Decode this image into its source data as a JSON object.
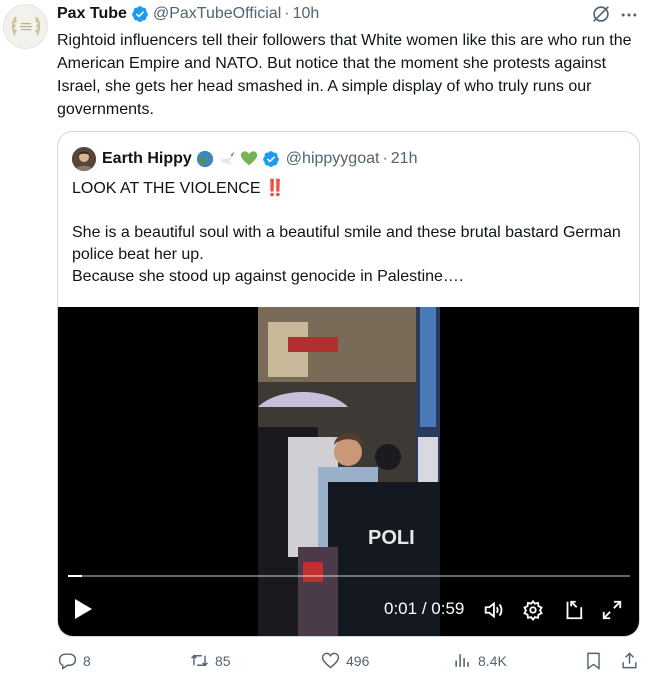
{
  "post": {
    "author_name": "Pax Tube",
    "author_handle": "@PaxTubeOfficial",
    "separator": "·",
    "timestamp": "10h",
    "text": "Rightoid influencers tell their followers that White women like this are who run the American Empire and NATO. But notice that the moment she protests against Israel, she gets her head smashed in. A simple display of who truly runs our governments."
  },
  "quote": {
    "author_name": "Earth Hippy",
    "author_handle": "@hippyygoat",
    "separator": "·",
    "timestamp": "21h",
    "line1": "LOOK AT THE VIOLENCE ‼️",
    "line2": "She is a beautiful soul with a beautiful smile and these brutal bastard German police beat her up.",
    "line3": "Because she stood up against genocide in Palestine…."
  },
  "video": {
    "time_current": "0:01",
    "time_total": "0:59",
    "time_sep": " / ",
    "progress": 0.025,
    "police_text": "POLI"
  },
  "actions": {
    "replies": "8",
    "reposts": "85",
    "likes": "496",
    "views": "8.4K"
  },
  "colors": {
    "verified": "#1d9bf0",
    "muted": "#536471",
    "text": "#0f1419",
    "border": "#cfd9de"
  }
}
